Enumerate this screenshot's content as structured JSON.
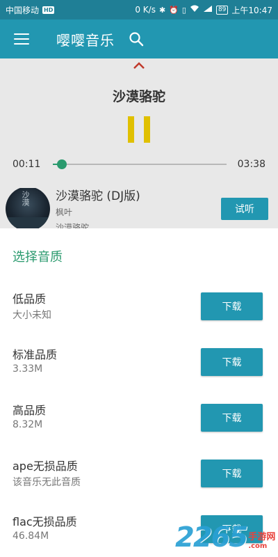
{
  "status_bar": {
    "carrier": "中国移动",
    "hd": "HD",
    "speed": "0 K/s",
    "battery": "89",
    "time": "上午10:47"
  },
  "app_bar": {
    "title": "嘤嘤音乐",
    "menu_icon": "hamburger-menu-icon",
    "search_icon": "search-icon"
  },
  "player": {
    "song_title": "沙漠骆驼",
    "current_time": "00:11",
    "total_time": "03:38",
    "progress": 0.05,
    "accent": "#2a9a6e",
    "pause_color": "#e0c000"
  },
  "song_row": {
    "title": "沙漠骆驼 (DJ版)",
    "artist": "枫叶",
    "album": "沙漠骆驼",
    "album_art_text": "沙漠",
    "listen_label": "试听"
  },
  "sheet": {
    "title": "选择音质",
    "items": [
      {
        "name": "低品质",
        "size": "大小未知",
        "button": "下载"
      },
      {
        "name": "标准品质",
        "size": "3.33M",
        "button": "下载"
      },
      {
        "name": "高品质",
        "size": "8.32M",
        "button": "下载"
      },
      {
        "name": "ape无损品质",
        "size": "该音乐无此音质",
        "button": "下载"
      },
      {
        "name": "flac无损品质",
        "size": "46.84M",
        "button": "下载"
      }
    ]
  },
  "watermark": {
    "number": "2265",
    "suffix": ".com",
    "cn": "手游网"
  },
  "colors": {
    "primary": "#2297b1",
    "status_bar": "#1f7f96",
    "title_green": "#2a9a6e"
  }
}
